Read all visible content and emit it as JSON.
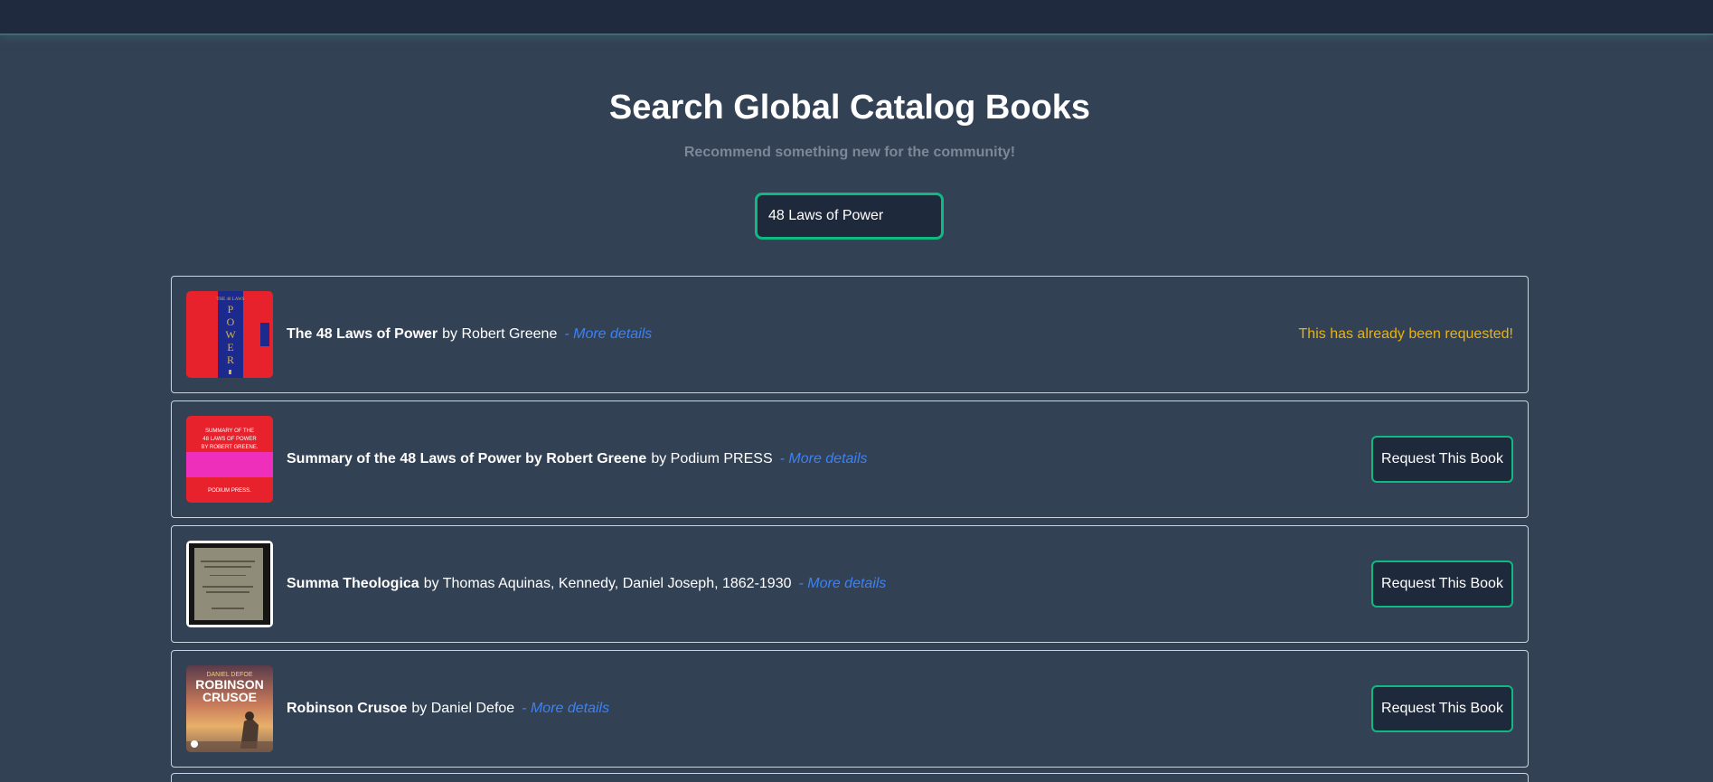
{
  "header": {
    "title": "Search Global Catalog Books",
    "subtitle": "Recommend something new for the community!"
  },
  "search": {
    "value": "48 Laws of Power"
  },
  "results": [
    {
      "title": "The 48 Laws of Power",
      "author_text": "by Robert Greene",
      "details_link": "- More details",
      "status": "This has already been requested!",
      "cover_word": "POWER"
    },
    {
      "title": "Summary of the 48 Laws of Power by Robert Greene",
      "author_text": "by Podium PRESS",
      "details_link": "- More details",
      "button_label": "Request This Book",
      "cover_line1": "SUMMARY OF THE",
      "cover_line2": "48 LAWS OF POWER",
      "cover_line3": "BY ROBERT GREENE.",
      "cover_publisher": "PODIUM PRESS."
    },
    {
      "title": "Summa Theologica",
      "author_text": "by Thomas Aquinas, Kennedy, Daniel Joseph, 1862-1930",
      "details_link": "- More details",
      "button_label": "Request This Book"
    },
    {
      "title": "Robinson Crusoe",
      "author_text": "by Daniel Defoe",
      "details_link": "- More details",
      "button_label": "Request This Book",
      "cover_author": "DANIEL DEFOE",
      "cover_title1": "ROBINSON",
      "cover_title2": "CRUSOE"
    }
  ],
  "colors": {
    "background": "#334155",
    "accent": "#10b981",
    "link": "#3b82f6",
    "warning": "#eab308"
  }
}
